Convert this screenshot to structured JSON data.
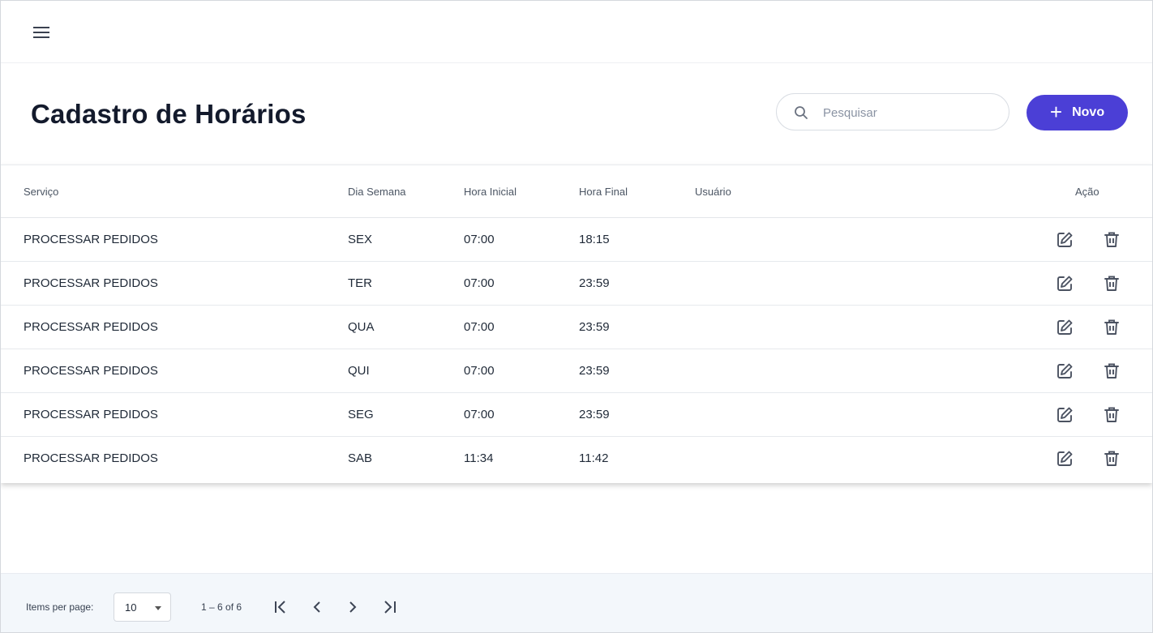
{
  "header": {
    "title": "Cadastro de Horários",
    "search_placeholder": "Pesquisar",
    "new_button_label": "Novo",
    "accent_color": "#4b3fd6"
  },
  "table": {
    "columns": {
      "servico": "Serviço",
      "dia_semana": "Dia Semana",
      "hora_inicial": "Hora Inicial",
      "hora_final": "Hora Final",
      "usuario": "Usuário",
      "acao": "Ação"
    },
    "rows": [
      {
        "servico": "PROCESSAR PEDIDOS",
        "dia": "SEX",
        "inicio": "07:00",
        "fim": "18:15",
        "usuario": ""
      },
      {
        "servico": "PROCESSAR PEDIDOS",
        "dia": "TER",
        "inicio": "07:00",
        "fim": "23:59",
        "usuario": ""
      },
      {
        "servico": "PROCESSAR PEDIDOS",
        "dia": "QUA",
        "inicio": "07:00",
        "fim": "23:59",
        "usuario": ""
      },
      {
        "servico": "PROCESSAR PEDIDOS",
        "dia": "QUI",
        "inicio": "07:00",
        "fim": "23:59",
        "usuario": ""
      },
      {
        "servico": "PROCESSAR PEDIDOS",
        "dia": "SEG",
        "inicio": "07:00",
        "fim": "23:59",
        "usuario": ""
      },
      {
        "servico": "PROCESSAR PEDIDOS",
        "dia": "SAB",
        "inicio": "11:34",
        "fim": "11:42",
        "usuario": ""
      }
    ],
    "row_icons": [
      "edit-icon",
      "trash-icon"
    ]
  },
  "paginator": {
    "items_per_page_label": "Items per page:",
    "items_per_page_value": "10",
    "range_label": "1 – 6 of 6"
  },
  "icons": {
    "menu": "hamburger-menu-icon",
    "search": "search-icon",
    "add": "plus-icon",
    "first": "first-page-icon",
    "prev": "chevron-left-icon",
    "next": "chevron-right-icon",
    "last": "last-page-icon"
  }
}
